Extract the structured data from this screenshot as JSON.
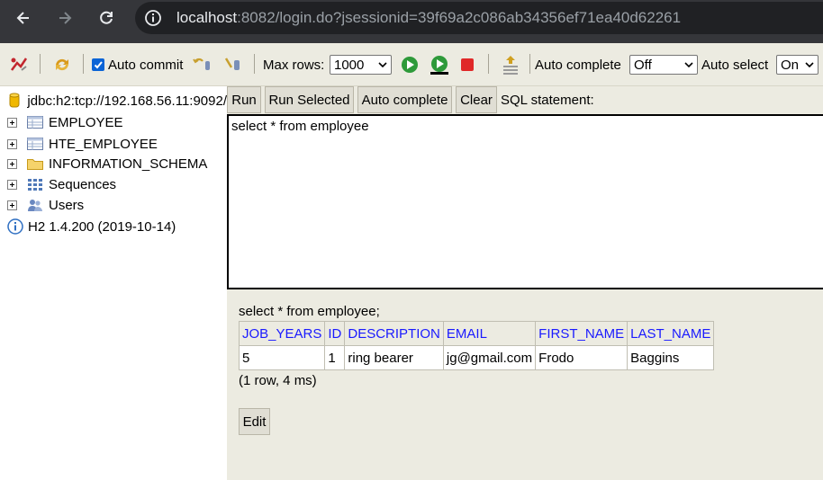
{
  "browser": {
    "url_host": "localhost",
    "url_rest": ":8082/login.do?jsessionid=39f69a2c086ab34356ef71ea40d62261"
  },
  "toolbar": {
    "auto_commit_label": "Auto commit",
    "auto_commit_checked": true,
    "max_rows_label": "Max rows:",
    "max_rows_value": "1000",
    "auto_complete_label": "Auto complete",
    "auto_complete_value": "Off",
    "auto_select_label": "Auto select",
    "auto_select_value": "On"
  },
  "tree": {
    "connection": "jdbc:h2:tcp://192.168.56.11:9092/",
    "items": [
      {
        "label": "EMPLOYEE",
        "icon": "table-icon"
      },
      {
        "label": "HTE_EMPLOYEE",
        "icon": "table-icon"
      },
      {
        "label": "INFORMATION_SCHEMA",
        "icon": "folder-icon"
      },
      {
        "label": "Sequences",
        "icon": "sequences-icon"
      },
      {
        "label": "Users",
        "icon": "users-icon"
      }
    ],
    "version": "H2 1.4.200 (2019-10-14)"
  },
  "buttons": {
    "run": "Run",
    "run_selected": "Run Selected",
    "auto_complete": "Auto complete",
    "clear": "Clear",
    "sql_statement_label": "SQL statement:"
  },
  "editor": {
    "sql": "select * from employee"
  },
  "result": {
    "query": "select * from employee;",
    "columns": [
      "JOB_YEARS",
      "ID",
      "DESCRIPTION",
      "EMAIL",
      "FIRST_NAME",
      "LAST_NAME"
    ],
    "rows": [
      [
        "5",
        "1",
        "ring bearer",
        "jg@gmail.com",
        "Frodo",
        "Baggins"
      ]
    ],
    "summary": "(1 row, 4 ms)",
    "edit_label": "Edit"
  },
  "colors": {
    "chrome_bg": "#35363a",
    "urlbar_bg": "#202124",
    "panel_bg": "#ecebe1",
    "header_link": "#1a1aff"
  }
}
